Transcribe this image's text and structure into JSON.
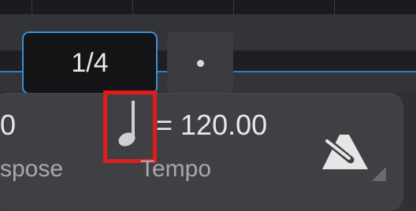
{
  "grid": {
    "note_value": "1/4"
  },
  "transpose": {
    "value": "0",
    "label": "spose"
  },
  "tempo": {
    "equals_value": "= 120.00",
    "label": "Tempo"
  },
  "icons": {
    "dot": "dot-icon",
    "note": "quarter-note-icon",
    "metronome": "metronome-icon"
  },
  "colors": {
    "accent_blue": "#3c8fd6",
    "highlight_red": "#e31b1b",
    "panel": "#3f4043"
  }
}
